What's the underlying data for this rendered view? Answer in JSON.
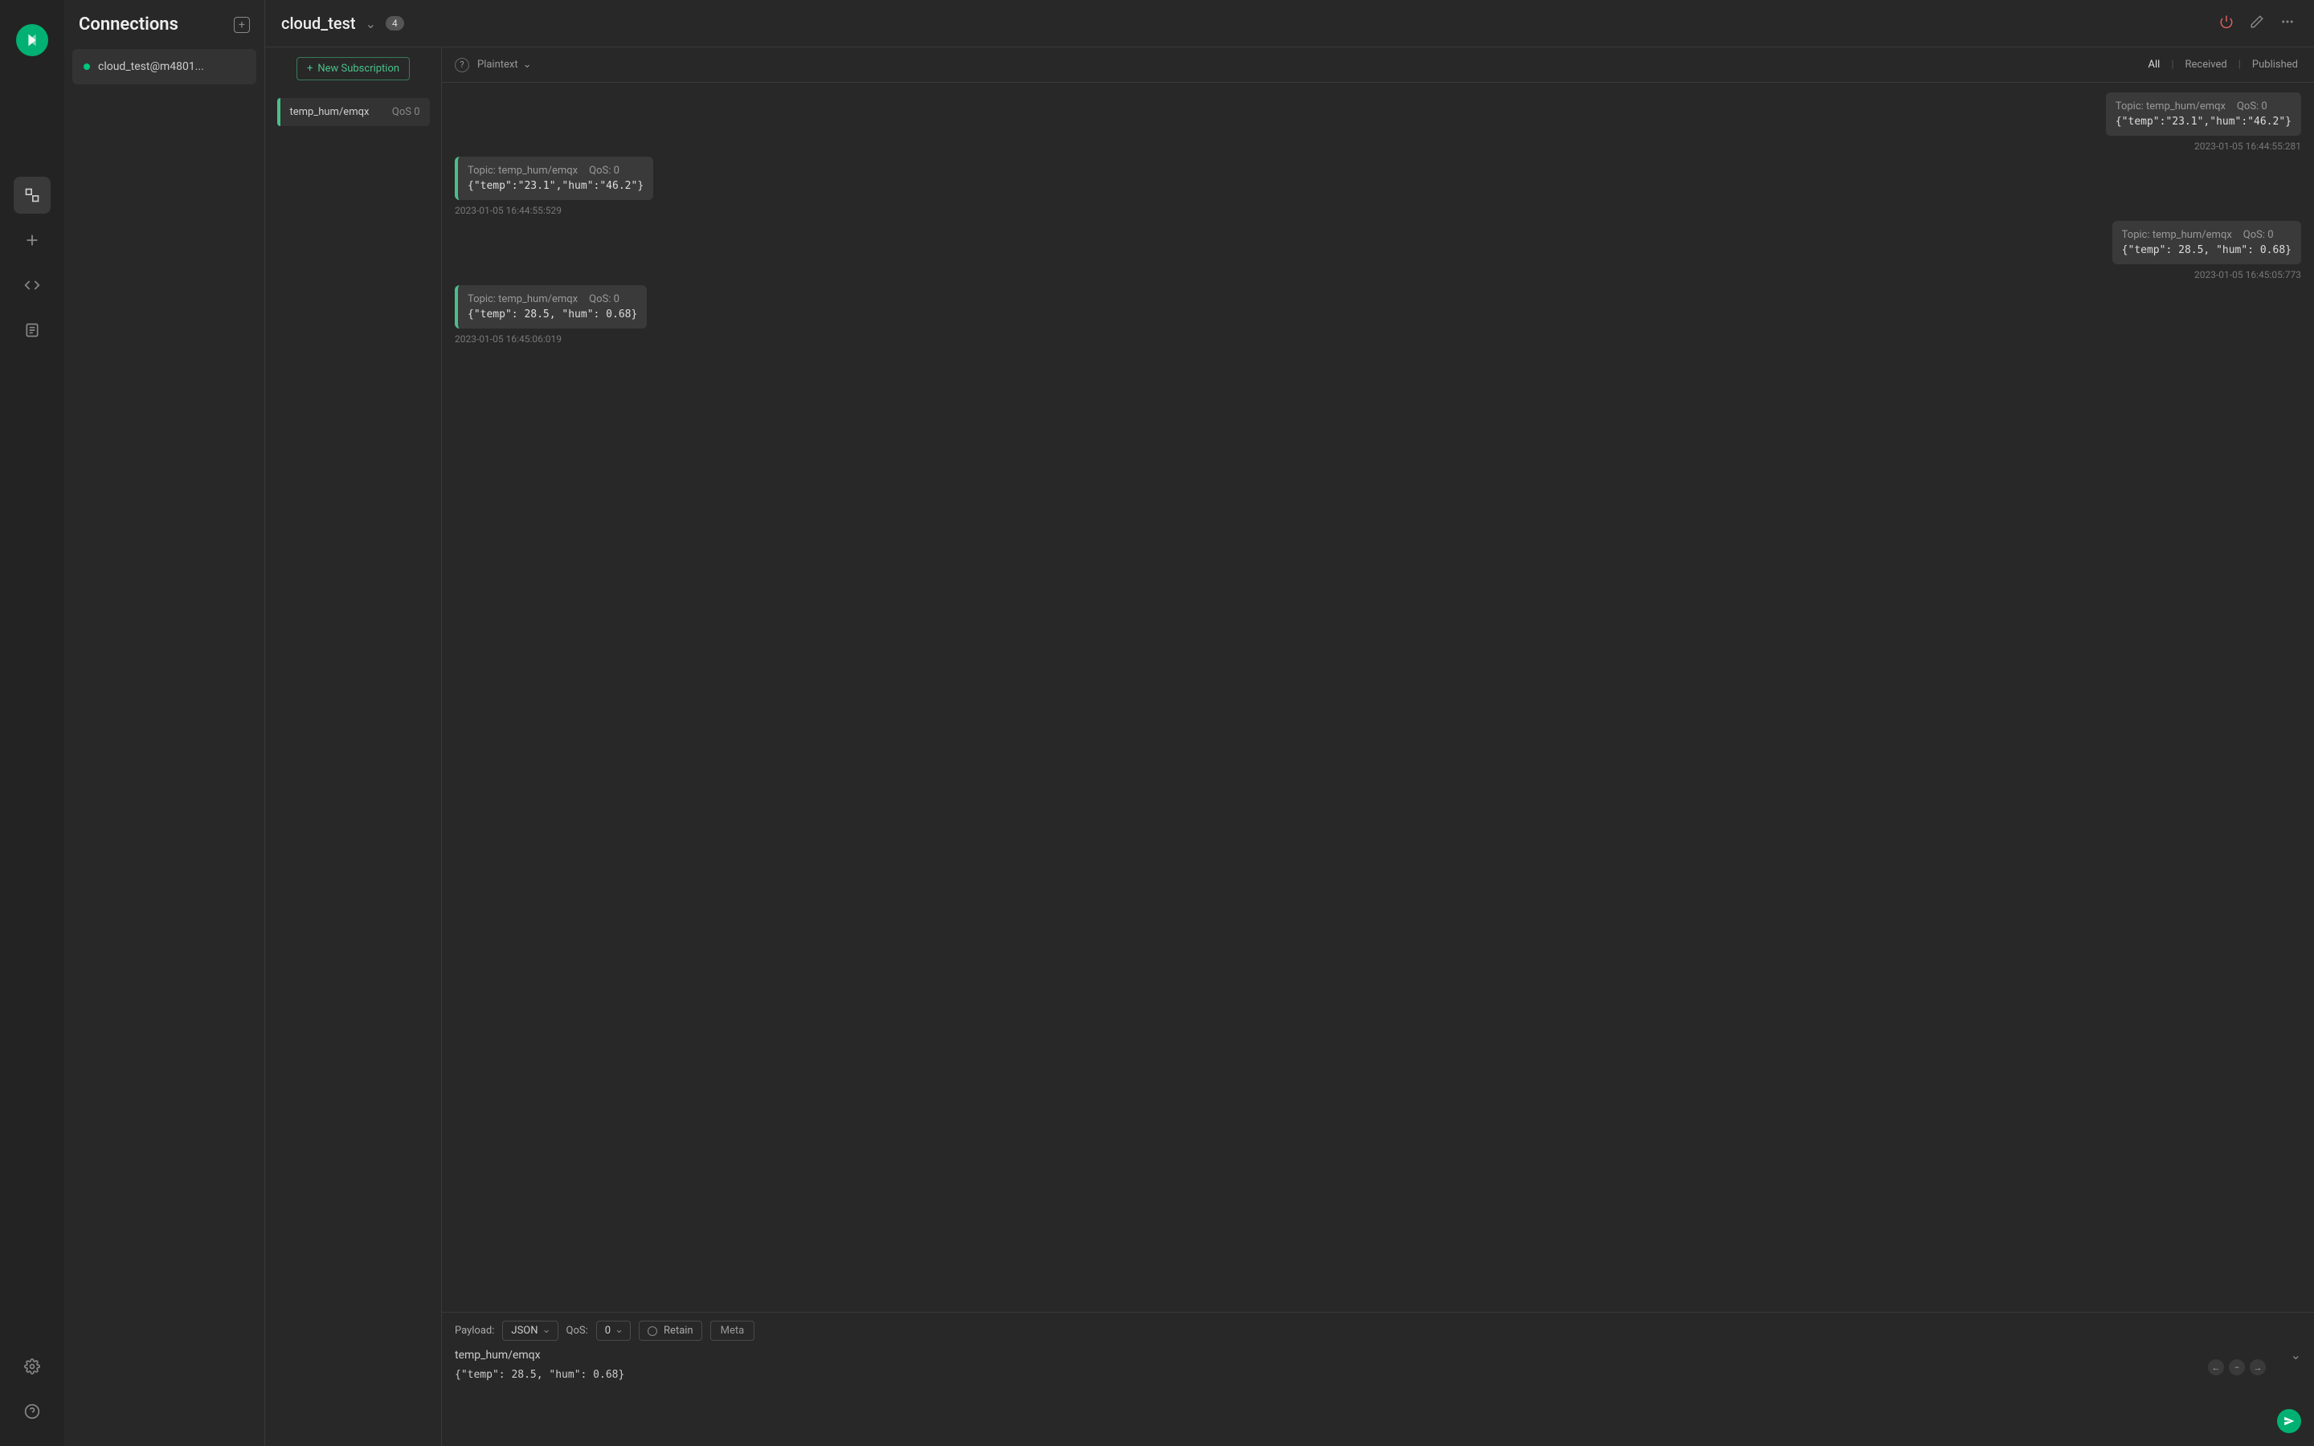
{
  "sidebar": {
    "title": "Connections",
    "connection": "cloud_test@m4801..."
  },
  "header": {
    "title": "cloud_test",
    "badge": "4"
  },
  "subs": {
    "new_label": "New Subscription",
    "item": {
      "topic": "temp_hum/emqx",
      "qos": "QoS 0"
    }
  },
  "chat_head": {
    "format": "Plaintext",
    "tabs": {
      "all": "All",
      "received": "Received",
      "published": "Published"
    }
  },
  "messages": [
    {
      "dir": "sent",
      "topic": "Topic: temp_hum/emqx",
      "qos": "QoS: 0",
      "payload": "{\"temp\":\"23.1\",\"hum\":\"46.2\"}",
      "ts": "2023-01-05 16:44:55:281"
    },
    {
      "dir": "recv",
      "topic": "Topic: temp_hum/emqx",
      "qos": "QoS: 0",
      "payload": "{\"temp\":\"23.1\",\"hum\":\"46.2\"}",
      "ts": "2023-01-05 16:44:55:529"
    },
    {
      "dir": "sent",
      "topic": "Topic: temp_hum/emqx",
      "qos": "QoS: 0",
      "payload": "{\"temp\": 28.5, \"hum\": 0.68}",
      "ts": "2023-01-05 16:45:05:773"
    },
    {
      "dir": "recv",
      "topic": "Topic: temp_hum/emqx",
      "qos": "QoS: 0",
      "payload": "{\"temp\": 28.5, \"hum\": 0.68}",
      "ts": "2023-01-05 16:45:06:019"
    }
  ],
  "composer": {
    "payload_label": "Payload:",
    "payload_fmt": "JSON",
    "qos_label": "QoS:",
    "qos_val": "0",
    "retain": "Retain",
    "meta": "Meta",
    "topic": "temp_hum/emqx",
    "body": "{\"temp\": 28.5, \"hum\": 0.68}"
  }
}
